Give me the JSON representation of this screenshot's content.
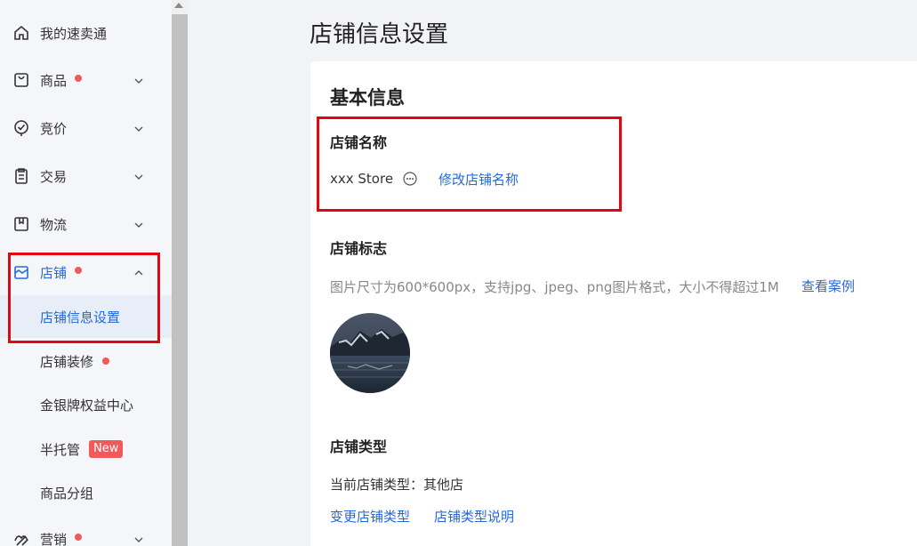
{
  "sidebar": {
    "items": [
      {
        "label": "我的速卖通",
        "icon": "home-icon"
      },
      {
        "label": "商品",
        "icon": "bag-icon",
        "dot": true
      },
      {
        "label": "竞价",
        "icon": "bid-icon"
      },
      {
        "label": "交易",
        "icon": "clipboard-icon"
      },
      {
        "label": "物流",
        "icon": "box-icon"
      },
      {
        "label": "店铺",
        "icon": "store-icon",
        "dot": true,
        "expanded": true
      }
    ],
    "store_sub": [
      {
        "label": "店铺信息设置",
        "active": true
      },
      {
        "label": "店铺装修",
        "dot": true
      },
      {
        "label": "金银牌权益中心"
      },
      {
        "label": "半托管",
        "badge": "New"
      },
      {
        "label": "商品分组"
      }
    ],
    "marketing": {
      "label": "营销",
      "icon": "marketing-icon",
      "dot": true
    }
  },
  "page": {
    "title": "店铺信息设置"
  },
  "basic_info": {
    "heading": "基本信息",
    "store_name_label": "店铺名称",
    "store_name_value": "xxx Store",
    "edit_name_link": "修改店铺名称",
    "logo_label": "店铺标志",
    "logo_hint": "图片尺寸为600*600px，支持jpg、jpeg、png图片格式，大小不得超过1M",
    "view_example_link": "查看案例",
    "type_label": "店铺类型",
    "current_type_text": "当前店铺类型：其他店",
    "change_type_link": "变更店铺类型",
    "type_desc_link": "店铺类型说明"
  },
  "colors": {
    "accent": "#2769d6",
    "highlight_box": "#e0070f",
    "dot": "#f05a5a"
  }
}
